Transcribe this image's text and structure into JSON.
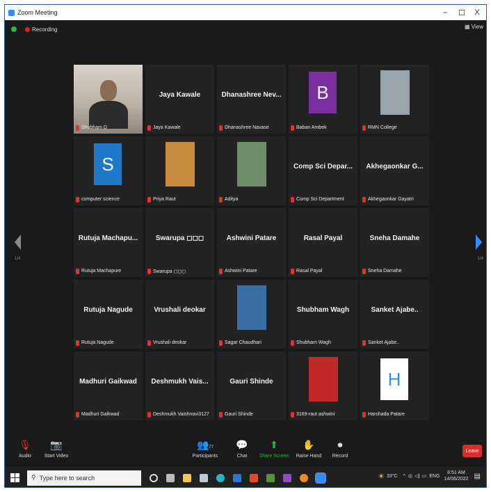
{
  "window": {
    "title": "Zoom Meeting",
    "minimize": "–",
    "maximize": "☐",
    "close": "X"
  },
  "topbar": {
    "recording": "Recording",
    "view": "View"
  },
  "nav": {
    "left_page": "1/4",
    "right_page": "1/4"
  },
  "tiles": [
    {
      "name": "",
      "label": "Shubham D",
      "kind": "video",
      "color": "#8a6b55"
    },
    {
      "name": "Jaya Kawale",
      "label": "Jaya Kawale",
      "kind": "name"
    },
    {
      "name": "Dhanashree Nev...",
      "label": "Dhanashree Navase",
      "kind": "name"
    },
    {
      "name": "",
      "label": "Baban Ambek",
      "kind": "letter",
      "letter": "B",
      "color": "#7b2fa0"
    },
    {
      "name": "",
      "label": "RMN College",
      "kind": "photo",
      "color": "#9aa6ae"
    },
    {
      "name": "",
      "label": "computer science",
      "kind": "letter",
      "letter": "S",
      "color": "#1f78c8"
    },
    {
      "name": "",
      "label": "Priya Raut",
      "kind": "photo",
      "color": "#c98b3d"
    },
    {
      "name": "",
      "label": "Aditya",
      "kind": "photo",
      "color": "#6f8d6a"
    },
    {
      "name": "Comp Sci Depar...",
      "label": "Comp Sci Department",
      "kind": "name"
    },
    {
      "name": "Akhegaonkar G...",
      "label": "Akhegaonkar Gayatri",
      "kind": "name"
    },
    {
      "name": "Rutuja Machapu...",
      "label": "Rutuja Machapure",
      "kind": "name"
    },
    {
      "name": "Swarupa ◻◻◻",
      "label": "Swarupa ◻◻◻",
      "kind": "name"
    },
    {
      "name": "Ashwini Patare",
      "label": "Ashwini Patare",
      "kind": "name"
    },
    {
      "name": "Rasal Payal",
      "label": "Rasal Payal",
      "kind": "name"
    },
    {
      "name": "Sneha Damahe",
      "label": "Sneha Damahe",
      "kind": "name"
    },
    {
      "name": "Rutuja Nagude",
      "label": "Rutuja Nagude",
      "kind": "name"
    },
    {
      "name": "Vrushali deokar",
      "label": "Vrushali deokar",
      "kind": "name"
    },
    {
      "name": "",
      "label": "Sagar Chaudhari",
      "kind": "photo",
      "color": "#3a6ea5"
    },
    {
      "name": "Shubham Wagh",
      "label": "Shubham Wagh",
      "kind": "name"
    },
    {
      "name": "Sanket Ajabe..",
      "label": "Sanket Ajabe..",
      "kind": "name"
    },
    {
      "name": "Madhuri Gaikwad",
      "label": "Madhuri Gaikwad",
      "kind": "name"
    },
    {
      "name": "Deshmukh Vais...",
      "label": "Deshmukh Vaishnavi3127",
      "kind": "name"
    },
    {
      "name": "Gauri Shinde",
      "label": "Gauri Shinde",
      "kind": "name"
    },
    {
      "name": "",
      "label": "3169-raut ashwini",
      "kind": "photo",
      "color": "#c22a2a"
    },
    {
      "name": "",
      "label": "Harshada Patare",
      "kind": "letter",
      "letter": "H",
      "color": "#ffffff",
      "letter_color": "#2d8cff"
    }
  ],
  "controls": {
    "audio": "Audio",
    "start_video": "Start Video",
    "participants": "Participants",
    "participants_count": "77",
    "chat": "Chat",
    "share_screen": "Share Screen",
    "raise_hand": "Raise Hand",
    "record": "Record",
    "leave": "Leave"
  },
  "taskbar": {
    "search_placeholder": "Type here to search",
    "weather": "33°C",
    "language": "ENG",
    "time": "8:51 AM",
    "date": "14/06/2022"
  }
}
